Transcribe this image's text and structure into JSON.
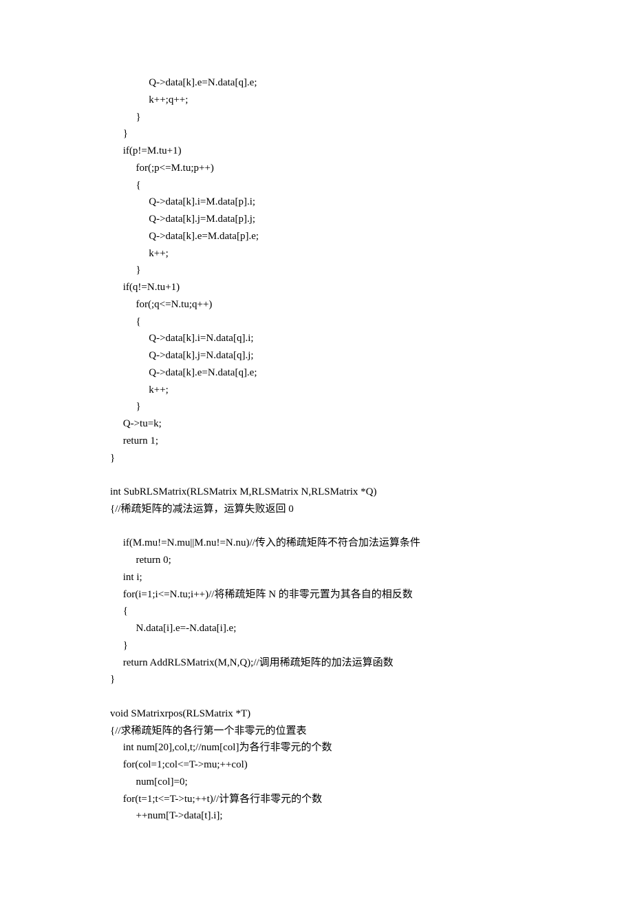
{
  "lines": [
    "               Q->data[k].e=N.data[q].e;",
    "               k++;q++;",
    "          }",
    "     }",
    "     if(p!=M.tu+1)",
    "          for(;p<=M.tu;p++)",
    "          {",
    "               Q->data[k].i=M.data[p].i;",
    "               Q->data[k].j=M.data[p].j;",
    "               Q->data[k].e=M.data[p].e;",
    "               k++;",
    "          }",
    "     if(q!=N.tu+1)",
    "          for(;q<=N.tu;q++)",
    "          {",
    "               Q->data[k].i=N.data[q].i;",
    "               Q->data[k].j=N.data[q].j;",
    "               Q->data[k].e=N.data[q].e;",
    "               k++;",
    "          }",
    "     Q->tu=k;",
    "     return 1;",
    "}",
    "",
    "int SubRLSMatrix(RLSMatrix M,RLSMatrix N,RLSMatrix *Q)",
    "{//稀疏矩阵的减法运算，运算失败返回 0",
    "",
    "     if(M.mu!=N.mu||M.nu!=N.nu)//传入的稀疏矩阵不符合加法运算条件",
    "          return 0;",
    "     int i;",
    "     for(i=1;i<=N.tu;i++)//将稀疏矩阵 N 的非零元置为其各自的相反数",
    "     {",
    "          N.data[i].e=-N.data[i].e;",
    "     }",
    "     return AddRLSMatrix(M,N,Q);//调用稀疏矩阵的加法运算函数",
    "}",
    "",
    "void SMatrixrpos(RLSMatrix *T)",
    "{//求稀疏矩阵的各行第一个非零元的位置表",
    "     int num[20],col,t;//num[col]为各行非零元的个数",
    "     for(col=1;col<=T->mu;++col)",
    "          num[col]=0;",
    "     for(t=1;t<=T->tu;++t)//计算各行非零元的个数",
    "          ++num[T->data[t].i];"
  ]
}
